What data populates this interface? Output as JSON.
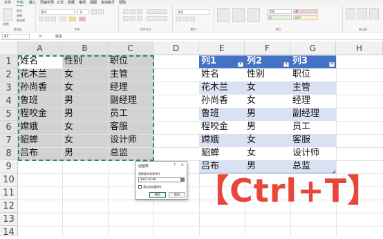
{
  "menu": {
    "items": [
      "文件",
      "开始",
      "插入",
      "页面布局",
      "公式",
      "数据",
      "审阅",
      "视图",
      "自动执行",
      "帮助"
    ],
    "active_index": 1
  },
  "ribbon": {
    "groups": [
      "剪贴板",
      "字体",
      "对齐方式",
      "数字",
      "样式",
      "单元格"
    ],
    "clipboard": {
      "paste": "粘贴",
      "cut": "剪切",
      "copy": "复制",
      "format": "格式刷"
    },
    "font": {
      "name": "等线",
      "size": "11"
    },
    "number": {
      "format": "常规"
    },
    "styles": {
      "cond": "条件格式",
      "table": "套用表格格式",
      "cell": "单元格样式",
      "normal": "常规",
      "bad": "差",
      "good": "好",
      "neutral": "适中",
      "calc": "计算",
      "check": "检查单元格"
    },
    "cells": {
      "insert": "插入",
      "delete": "删除",
      "format": "格式"
    }
  },
  "formula_bar": {
    "name_box": "A1",
    "fx": "fx",
    "value": "姓名"
  },
  "grid": {
    "columns": [
      "A",
      "B",
      "C",
      "D",
      "E",
      "F",
      "G",
      "H"
    ],
    "rows": [
      "1",
      "2",
      "3",
      "4",
      "5",
      "6",
      "7",
      "8",
      "9",
      "10",
      "11",
      "12",
      "13",
      "14"
    ],
    "selected_columns": [
      "A",
      "B",
      "C"
    ],
    "selected_rows": [
      "1",
      "2",
      "3",
      "4",
      "5",
      "6",
      "7",
      "8"
    ]
  },
  "source_table": {
    "rows": [
      [
        "姓名",
        "性别",
        "职位"
      ],
      [
        "花木兰",
        "女",
        "主管"
      ],
      [
        "孙尚香",
        "女",
        "经理"
      ],
      [
        "鲁班",
        "男",
        "副经理"
      ],
      [
        "程咬金",
        "男",
        "员工"
      ],
      [
        "嫦娥",
        "女",
        "客服"
      ],
      [
        "貂蝉",
        "女",
        "设计师"
      ],
      [
        "吕布",
        "男",
        "总监"
      ]
    ]
  },
  "result_table": {
    "headers": [
      "列1",
      "列2",
      "列3"
    ],
    "rows": [
      [
        "姓名",
        "性别",
        "职位"
      ],
      [
        "花木兰",
        "女",
        "主管"
      ],
      [
        "孙尚香",
        "女",
        "经理"
      ],
      [
        "鲁班",
        "男",
        "副经理"
      ],
      [
        "程咬金",
        "男",
        "员工"
      ],
      [
        "嫦娥",
        "女",
        "客服"
      ],
      [
        "貂蝉",
        "女",
        "设计师"
      ],
      [
        "吕布",
        "男",
        "总监"
      ]
    ],
    "header_color": "#4472c4",
    "band_color": "#d9e1f2"
  },
  "dialog": {
    "title": "创建表",
    "help": "?",
    "close": "×",
    "range_label": "表数据的来源(W):",
    "range_value": "$A$1:$C$8",
    "checkbox_label": "表包含标题(M)",
    "ok": "确定",
    "cancel": "取消"
  },
  "overlay_text": "【Ctrl+T】",
  "colors": {
    "accent_green": "#1e6e3a",
    "overlay_red": "#e8463b",
    "marching_ants": "#2e8b57"
  }
}
